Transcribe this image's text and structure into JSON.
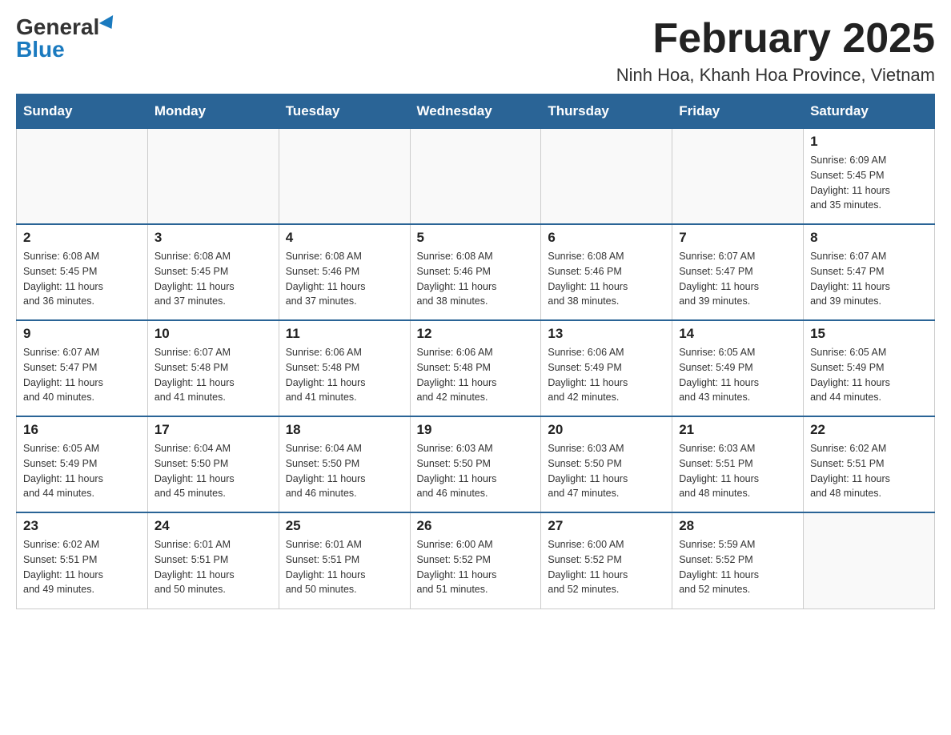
{
  "logo": {
    "general": "General",
    "blue": "Blue"
  },
  "header": {
    "month": "February 2025",
    "location": "Ninh Hoa, Khanh Hoa Province, Vietnam"
  },
  "weekdays": [
    "Sunday",
    "Monday",
    "Tuesday",
    "Wednesday",
    "Thursday",
    "Friday",
    "Saturday"
  ],
  "weeks": [
    [
      {
        "day": "",
        "info": ""
      },
      {
        "day": "",
        "info": ""
      },
      {
        "day": "",
        "info": ""
      },
      {
        "day": "",
        "info": ""
      },
      {
        "day": "",
        "info": ""
      },
      {
        "day": "",
        "info": ""
      },
      {
        "day": "1",
        "info": "Sunrise: 6:09 AM\nSunset: 5:45 PM\nDaylight: 11 hours\nand 35 minutes."
      }
    ],
    [
      {
        "day": "2",
        "info": "Sunrise: 6:08 AM\nSunset: 5:45 PM\nDaylight: 11 hours\nand 36 minutes."
      },
      {
        "day": "3",
        "info": "Sunrise: 6:08 AM\nSunset: 5:45 PM\nDaylight: 11 hours\nand 37 minutes."
      },
      {
        "day": "4",
        "info": "Sunrise: 6:08 AM\nSunset: 5:46 PM\nDaylight: 11 hours\nand 37 minutes."
      },
      {
        "day": "5",
        "info": "Sunrise: 6:08 AM\nSunset: 5:46 PM\nDaylight: 11 hours\nand 38 minutes."
      },
      {
        "day": "6",
        "info": "Sunrise: 6:08 AM\nSunset: 5:46 PM\nDaylight: 11 hours\nand 38 minutes."
      },
      {
        "day": "7",
        "info": "Sunrise: 6:07 AM\nSunset: 5:47 PM\nDaylight: 11 hours\nand 39 minutes."
      },
      {
        "day": "8",
        "info": "Sunrise: 6:07 AM\nSunset: 5:47 PM\nDaylight: 11 hours\nand 39 minutes."
      }
    ],
    [
      {
        "day": "9",
        "info": "Sunrise: 6:07 AM\nSunset: 5:47 PM\nDaylight: 11 hours\nand 40 minutes."
      },
      {
        "day": "10",
        "info": "Sunrise: 6:07 AM\nSunset: 5:48 PM\nDaylight: 11 hours\nand 41 minutes."
      },
      {
        "day": "11",
        "info": "Sunrise: 6:06 AM\nSunset: 5:48 PM\nDaylight: 11 hours\nand 41 minutes."
      },
      {
        "day": "12",
        "info": "Sunrise: 6:06 AM\nSunset: 5:48 PM\nDaylight: 11 hours\nand 42 minutes."
      },
      {
        "day": "13",
        "info": "Sunrise: 6:06 AM\nSunset: 5:49 PM\nDaylight: 11 hours\nand 42 minutes."
      },
      {
        "day": "14",
        "info": "Sunrise: 6:05 AM\nSunset: 5:49 PM\nDaylight: 11 hours\nand 43 minutes."
      },
      {
        "day": "15",
        "info": "Sunrise: 6:05 AM\nSunset: 5:49 PM\nDaylight: 11 hours\nand 44 minutes."
      }
    ],
    [
      {
        "day": "16",
        "info": "Sunrise: 6:05 AM\nSunset: 5:49 PM\nDaylight: 11 hours\nand 44 minutes."
      },
      {
        "day": "17",
        "info": "Sunrise: 6:04 AM\nSunset: 5:50 PM\nDaylight: 11 hours\nand 45 minutes."
      },
      {
        "day": "18",
        "info": "Sunrise: 6:04 AM\nSunset: 5:50 PM\nDaylight: 11 hours\nand 46 minutes."
      },
      {
        "day": "19",
        "info": "Sunrise: 6:03 AM\nSunset: 5:50 PM\nDaylight: 11 hours\nand 46 minutes."
      },
      {
        "day": "20",
        "info": "Sunrise: 6:03 AM\nSunset: 5:50 PM\nDaylight: 11 hours\nand 47 minutes."
      },
      {
        "day": "21",
        "info": "Sunrise: 6:03 AM\nSunset: 5:51 PM\nDaylight: 11 hours\nand 48 minutes."
      },
      {
        "day": "22",
        "info": "Sunrise: 6:02 AM\nSunset: 5:51 PM\nDaylight: 11 hours\nand 48 minutes."
      }
    ],
    [
      {
        "day": "23",
        "info": "Sunrise: 6:02 AM\nSunset: 5:51 PM\nDaylight: 11 hours\nand 49 minutes."
      },
      {
        "day": "24",
        "info": "Sunrise: 6:01 AM\nSunset: 5:51 PM\nDaylight: 11 hours\nand 50 minutes."
      },
      {
        "day": "25",
        "info": "Sunrise: 6:01 AM\nSunset: 5:51 PM\nDaylight: 11 hours\nand 50 minutes."
      },
      {
        "day": "26",
        "info": "Sunrise: 6:00 AM\nSunset: 5:52 PM\nDaylight: 11 hours\nand 51 minutes."
      },
      {
        "day": "27",
        "info": "Sunrise: 6:00 AM\nSunset: 5:52 PM\nDaylight: 11 hours\nand 52 minutes."
      },
      {
        "day": "28",
        "info": "Sunrise: 5:59 AM\nSunset: 5:52 PM\nDaylight: 11 hours\nand 52 minutes."
      },
      {
        "day": "",
        "info": ""
      }
    ]
  ]
}
